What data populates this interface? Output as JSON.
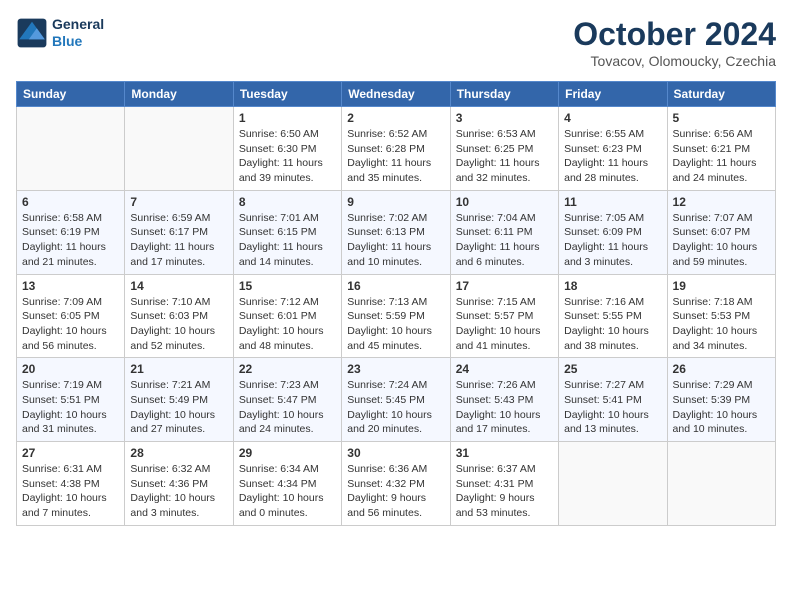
{
  "header": {
    "logo_line1": "General",
    "logo_line2": "Blue",
    "month": "October 2024",
    "location": "Tovacov, Olomoucky, Czechia"
  },
  "days_of_week": [
    "Sunday",
    "Monday",
    "Tuesday",
    "Wednesday",
    "Thursday",
    "Friday",
    "Saturday"
  ],
  "weeks": [
    [
      {
        "day": "",
        "info": ""
      },
      {
        "day": "",
        "info": ""
      },
      {
        "day": "1",
        "info": "Sunrise: 6:50 AM\nSunset: 6:30 PM\nDaylight: 11 hours and 39 minutes."
      },
      {
        "day": "2",
        "info": "Sunrise: 6:52 AM\nSunset: 6:28 PM\nDaylight: 11 hours and 35 minutes."
      },
      {
        "day": "3",
        "info": "Sunrise: 6:53 AM\nSunset: 6:25 PM\nDaylight: 11 hours and 32 minutes."
      },
      {
        "day": "4",
        "info": "Sunrise: 6:55 AM\nSunset: 6:23 PM\nDaylight: 11 hours and 28 minutes."
      },
      {
        "day": "5",
        "info": "Sunrise: 6:56 AM\nSunset: 6:21 PM\nDaylight: 11 hours and 24 minutes."
      }
    ],
    [
      {
        "day": "6",
        "info": "Sunrise: 6:58 AM\nSunset: 6:19 PM\nDaylight: 11 hours and 21 minutes."
      },
      {
        "day": "7",
        "info": "Sunrise: 6:59 AM\nSunset: 6:17 PM\nDaylight: 11 hours and 17 minutes."
      },
      {
        "day": "8",
        "info": "Sunrise: 7:01 AM\nSunset: 6:15 PM\nDaylight: 11 hours and 14 minutes."
      },
      {
        "day": "9",
        "info": "Sunrise: 7:02 AM\nSunset: 6:13 PM\nDaylight: 11 hours and 10 minutes."
      },
      {
        "day": "10",
        "info": "Sunrise: 7:04 AM\nSunset: 6:11 PM\nDaylight: 11 hours and 6 minutes."
      },
      {
        "day": "11",
        "info": "Sunrise: 7:05 AM\nSunset: 6:09 PM\nDaylight: 11 hours and 3 minutes."
      },
      {
        "day": "12",
        "info": "Sunrise: 7:07 AM\nSunset: 6:07 PM\nDaylight: 10 hours and 59 minutes."
      }
    ],
    [
      {
        "day": "13",
        "info": "Sunrise: 7:09 AM\nSunset: 6:05 PM\nDaylight: 10 hours and 56 minutes."
      },
      {
        "day": "14",
        "info": "Sunrise: 7:10 AM\nSunset: 6:03 PM\nDaylight: 10 hours and 52 minutes."
      },
      {
        "day": "15",
        "info": "Sunrise: 7:12 AM\nSunset: 6:01 PM\nDaylight: 10 hours and 48 minutes."
      },
      {
        "day": "16",
        "info": "Sunrise: 7:13 AM\nSunset: 5:59 PM\nDaylight: 10 hours and 45 minutes."
      },
      {
        "day": "17",
        "info": "Sunrise: 7:15 AM\nSunset: 5:57 PM\nDaylight: 10 hours and 41 minutes."
      },
      {
        "day": "18",
        "info": "Sunrise: 7:16 AM\nSunset: 5:55 PM\nDaylight: 10 hours and 38 minutes."
      },
      {
        "day": "19",
        "info": "Sunrise: 7:18 AM\nSunset: 5:53 PM\nDaylight: 10 hours and 34 minutes."
      }
    ],
    [
      {
        "day": "20",
        "info": "Sunrise: 7:19 AM\nSunset: 5:51 PM\nDaylight: 10 hours and 31 minutes."
      },
      {
        "day": "21",
        "info": "Sunrise: 7:21 AM\nSunset: 5:49 PM\nDaylight: 10 hours and 27 minutes."
      },
      {
        "day": "22",
        "info": "Sunrise: 7:23 AM\nSunset: 5:47 PM\nDaylight: 10 hours and 24 minutes."
      },
      {
        "day": "23",
        "info": "Sunrise: 7:24 AM\nSunset: 5:45 PM\nDaylight: 10 hours and 20 minutes."
      },
      {
        "day": "24",
        "info": "Sunrise: 7:26 AM\nSunset: 5:43 PM\nDaylight: 10 hours and 17 minutes."
      },
      {
        "day": "25",
        "info": "Sunrise: 7:27 AM\nSunset: 5:41 PM\nDaylight: 10 hours and 13 minutes."
      },
      {
        "day": "26",
        "info": "Sunrise: 7:29 AM\nSunset: 5:39 PM\nDaylight: 10 hours and 10 minutes."
      }
    ],
    [
      {
        "day": "27",
        "info": "Sunrise: 6:31 AM\nSunset: 4:38 PM\nDaylight: 10 hours and 7 minutes."
      },
      {
        "day": "28",
        "info": "Sunrise: 6:32 AM\nSunset: 4:36 PM\nDaylight: 10 hours and 3 minutes."
      },
      {
        "day": "29",
        "info": "Sunrise: 6:34 AM\nSunset: 4:34 PM\nDaylight: 10 hours and 0 minutes."
      },
      {
        "day": "30",
        "info": "Sunrise: 6:36 AM\nSunset: 4:32 PM\nDaylight: 9 hours and 56 minutes."
      },
      {
        "day": "31",
        "info": "Sunrise: 6:37 AM\nSunset: 4:31 PM\nDaylight: 9 hours and 53 minutes."
      },
      {
        "day": "",
        "info": ""
      },
      {
        "day": "",
        "info": ""
      }
    ]
  ]
}
